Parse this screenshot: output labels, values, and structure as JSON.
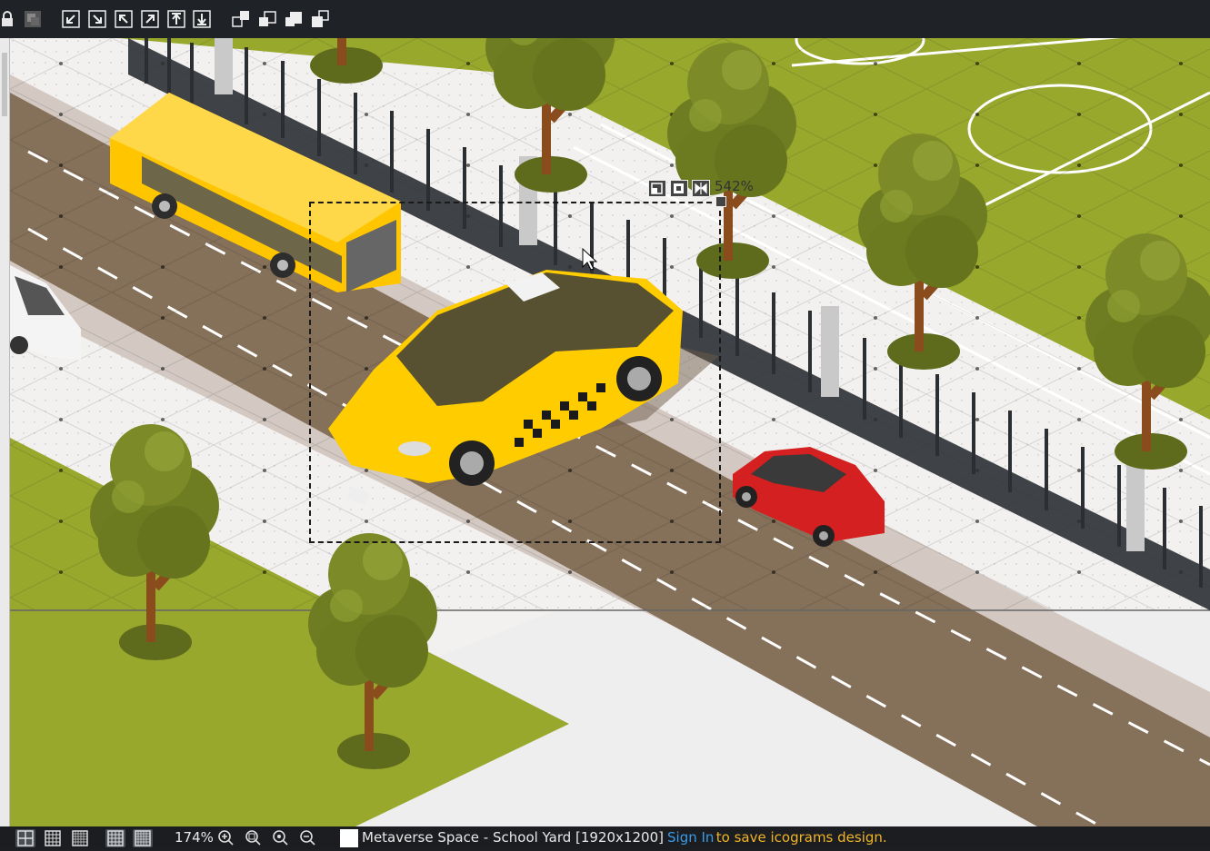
{
  "toolbar": {
    "lock": "lock-icon",
    "group": "layers-icon",
    "buttons": [
      "move-to-bottom-left-icon",
      "move-to-bottom-right-icon",
      "move-to-top-left-icon",
      "move-to-top-right-icon",
      "move-to-top-icon",
      "move-to-bottom-icon",
      "bring-to-front-icon",
      "bring-forward-icon",
      "send-backward-icon",
      "send-to-back-icon"
    ]
  },
  "canvas": {
    "selection": {
      "zoom_label": "542%",
      "controls": [
        "crop-icon",
        "fit-icon",
        "flip-icon"
      ]
    },
    "colors": {
      "road": "#85705a",
      "sidewalk": "#ece9e6",
      "grass": "#98a82d",
      "fence": "#2b2f33",
      "bus": "#ffc600",
      "taxi": "#ffcc00",
      "red_car": "#d42020",
      "tree": "#6f7d22"
    }
  },
  "statusbar": {
    "view_buttons": [
      "grid-view-icon",
      "dots-grid-icon",
      "fine-grid-icon",
      "snap-grid-icon",
      "snap-dots-icon"
    ],
    "zoom": "174%",
    "zoom_tools": [
      "zoom-in-icon",
      "zoom-fit-icon",
      "zoom-reset-icon",
      "zoom-out-icon"
    ],
    "design_title": "Metaverse Space - School Yard [1920x1200]",
    "sign_in": "Sign In",
    "sign_in_suffix": " to save icograms design.",
    "colors": {
      "link": "#3a9be8",
      "warn": "#f0b429"
    }
  }
}
